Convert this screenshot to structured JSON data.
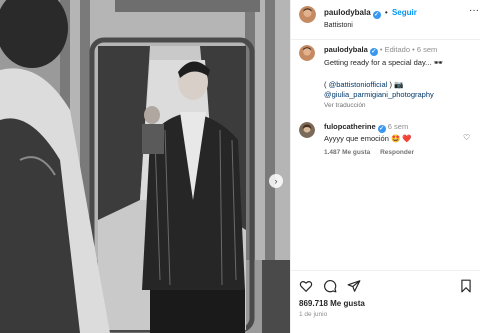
{
  "post": {
    "header": {
      "username": "paulodybala",
      "follow_label": "Seguir",
      "separator": "•",
      "subtitle": "Battistoni",
      "more_icon": "more-horizontal-icon"
    },
    "caption": {
      "username": "paulodybala",
      "edited": "• Editado •",
      "time": "6 sem",
      "text": "Getting ready for a special day... 🕶",
      "credit_prefix": "( ",
      "credit_handle": "@battistoniofficial",
      "credit_suffix": " ) 📷",
      "photographer": "@giulia_parmigiani_photography",
      "translate_label": "Ver traducción"
    },
    "comment": {
      "username": "fulopcatherine",
      "time": "6 sem",
      "text": "Ayyyy que emoción 🤩 ❤️",
      "likes": "1.487 Me gusta",
      "reply_label": "Responder"
    },
    "actions": {
      "likes": "869.718 Me gusta",
      "date": "1 de junio"
    }
  }
}
